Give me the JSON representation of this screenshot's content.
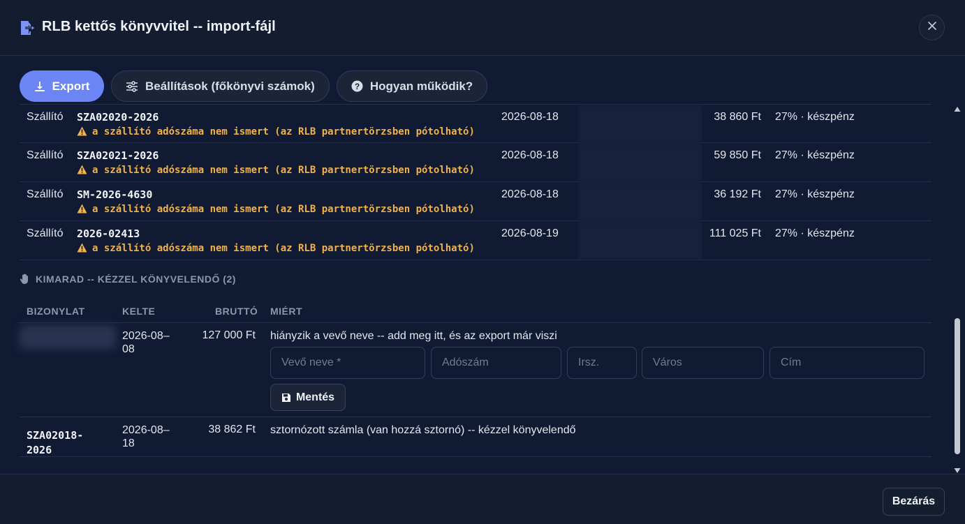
{
  "header": {
    "title": "RLB kettős könyvvitel -- import-fájl",
    "icon": "file-export-icon",
    "close_icon": "close-icon"
  },
  "toolbar": {
    "export_label": "Export",
    "settings_label": "Beállítások (főkönyvi számok)",
    "help_label": "Hogyan működik?",
    "colors": {
      "primary": "#6b86f4"
    }
  },
  "rows": [
    {
      "type": "Szállító",
      "doc": "SZA02020-2026",
      "warning": "a szállító adószáma nem ismert (az RLB partnertörzsben pótolható)",
      "date": "2026-08-18",
      "amount": "38 860 Ft",
      "vat": "27% · készpénz"
    },
    {
      "type": "Szállító",
      "doc": "SZA02021-2026",
      "warning": "a szállító adószáma nem ismert (az RLB partnertörzsben pótolható)",
      "date": "2026-08-18",
      "amount": "59 850 Ft",
      "vat": "27% · készpénz"
    },
    {
      "type": "Szállító",
      "doc": "SM-2026-4630",
      "warning": "a szállító adószáma nem ismert (az RLB partnertörzsben pótolható)",
      "date": "2026-08-18",
      "amount": "36 192 Ft",
      "vat": "27% · készpénz"
    },
    {
      "type": "Szállító",
      "doc": "2026-02413",
      "warning": "a szállító adószáma nem ismert (az RLB partnertörzsben pótolható)",
      "date": "2026-08-19",
      "amount": "111 025 Ft",
      "vat": "27% · készpénz"
    }
  ],
  "skip_section": {
    "title": "KIMARAD -- KÉZZEL KÖNYVELENDŐ (2)",
    "icon": "hand-icon",
    "columns": [
      "BIZONYLAT",
      "KELTE",
      "BRUTTÓ",
      "MIÉRT"
    ],
    "rows": [
      {
        "doc": "",
        "date": "2026-08-08",
        "date_line1": "2026-08–",
        "date_line2": "08",
        "amount": "127 000 Ft",
        "reason": "hiányzik a vevő neve -- add meg itt, és az export már viszi",
        "form": {
          "name_placeholder": "Vevő neve *",
          "tax_placeholder": "Adószám",
          "zip_placeholder": "Irsz.",
          "city_placeholder": "Város",
          "address_placeholder": "Cím",
          "save_label": "Mentés"
        }
      },
      {
        "doc": "SZA02018-2026",
        "doc_line1": "SZA02018-",
        "doc_line2": "2026",
        "date": "2026-08-18",
        "date_line1": "2026-08–",
        "date_line2": "18",
        "amount": "38 862 Ft",
        "reason": "sztornózott számla (van hozzá sztornó) -- kézzel könyvelendő"
      }
    ]
  },
  "footer": {
    "close_label": "Bezárás"
  }
}
